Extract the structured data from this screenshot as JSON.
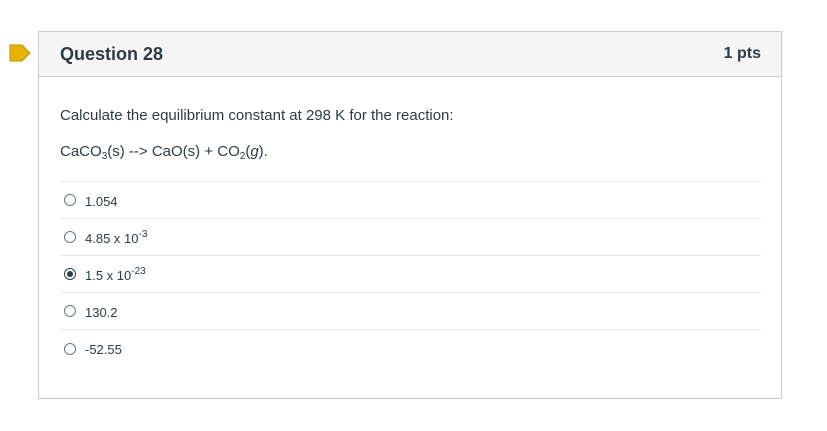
{
  "question": {
    "title": "Question 28",
    "points": "1 pts",
    "prompt": "Calculate the equilibrium constant at 298 K for the reaction:",
    "reaction": {
      "p1": "CaCO",
      "sub1": "3",
      "p2": "(s) --> CaO(s) + CO",
      "sub2": "2",
      "p3": "(",
      "italic": "g",
      "p4": ")."
    }
  },
  "answers": [
    {
      "base": "1.054",
      "sup": "",
      "checked": false
    },
    {
      "base": "4.85 x 10",
      "sup": "-3",
      "checked": false
    },
    {
      "base": "1.5 x 10",
      "sup": "-23",
      "checked": true
    },
    {
      "base": "130.2",
      "sup": "",
      "checked": false
    },
    {
      "base": "-52.55",
      "sup": "",
      "checked": false
    }
  ],
  "colors": {
    "flag": "#e8b107",
    "text": "#2d3b45",
    "border": "#c7cdd1",
    "header_bg": "#f5f5f5"
  },
  "icons": {
    "flag": "bookmark-flag-icon"
  }
}
